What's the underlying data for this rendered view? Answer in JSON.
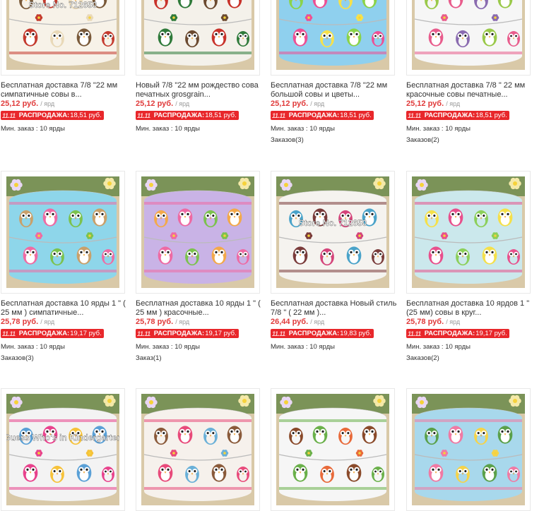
{
  "sale_badge": "11.11",
  "products": [
    {
      "title": "Бесплатная доставка 7/8 \"22 мм симпатичные совы в...",
      "price": "25,12 руб.",
      "unit": "/ ярд",
      "sale_label": "РАСПРОДАЖА:",
      "sale_price": "18,51 руб.",
      "min_order": "Мин. заказ : 10 ярды",
      "orders": "",
      "watermark": "Store No. 712650",
      "colors": [
        "#f7f2e8",
        "#c43a2e",
        "#7a5a3a",
        "#e9d9b8"
      ]
    },
    {
      "title": "Новый 7/8 \"22 мм рождество сова печатных grosgrain...",
      "price": "25,12 руб.",
      "unit": "/ ярд",
      "sale_label": "РАСПРОДАЖА:",
      "sale_price": "18,51 руб.",
      "min_order": "Мин. заказ : 10 ярды",
      "orders": "",
      "watermark": "",
      "colors": [
        "#f4f1ea",
        "#2f7a3a",
        "#c8322a",
        "#6b4a30"
      ]
    },
    {
      "title": "Бесплатная доставка 7/8 \"22 мм большой совы и цветы...",
      "price": "25,12 руб.",
      "unit": "/ ярд",
      "sale_label": "РАСПРОДАЖА:",
      "sale_price": "18,51 руб.",
      "min_order": "Мин. заказ : 10 ярды",
      "orders": "Заказов(3)",
      "watermark": "",
      "colors": [
        "#8fd0ee",
        "#ee4f93",
        "#8bd34a",
        "#f7e14a"
      ]
    },
    {
      "title": "Бесплатная доставка 7/8 \" 22 мм красочные совы печатные...",
      "price": "25,12 руб.",
      "unit": "/ ярд",
      "sale_label": "РАСПРОДАЖА:",
      "sale_price": "18,51 руб.",
      "min_order": "Мин. заказ : 10 ярды",
      "orders": "Заказов(2)",
      "watermark": "",
      "colors": [
        "#f6f6f6",
        "#e85c8c",
        "#9ac94a",
        "#8a6bb0"
      ]
    },
    {
      "title": "Бесплатная доставка 10 ярды 1 \" ( 25 мм ) симпатичные...",
      "price": "25,78 руб.",
      "unit": "/ ярд",
      "sale_label": "РАСПРОДАЖА:",
      "sale_price": "19,17 руб.",
      "min_order": "Мин. заказ : 10 ярды",
      "orders": "Заказов(3)",
      "watermark": "",
      "colors": [
        "#8ed6ea",
        "#ef6ba3",
        "#c9a06a",
        "#7cc24e"
      ]
    },
    {
      "title": "Бесплатная доставка 10 ярды 1 \" ( 25 мм ) красочные...",
      "price": "25,78 руб.",
      "unit": "/ ярд",
      "sale_label": "РАСПРОДАЖА:",
      "sale_price": "19,17 руб.",
      "min_order": "Мин. заказ : 10 ярды",
      "orders": "Заказ(1)",
      "watermark": "",
      "colors": [
        "#c9b3e6",
        "#ee6aa3",
        "#f3a94a",
        "#7cc24e"
      ]
    },
    {
      "title": "Бесплатная доставка Новый стиль 7/8 \" ( 22 мм )...",
      "price": "26,44 руб.",
      "unit": "/ ярд",
      "sale_label": "РАСПРОДАЖА:",
      "sale_price": "19,83 руб.",
      "min_order": "Мин. заказ : 10 ярды",
      "orders": "",
      "watermark": "Store No. 712650",
      "colors": [
        "#f5f3ef",
        "#7a3b3a",
        "#4aa3c9",
        "#d4447a"
      ]
    },
    {
      "title": "Бесплатная доставка 10 ярдов 1 \"(25 мм) совы в круг...",
      "price": "25,78 руб.",
      "unit": "/ ярд",
      "sale_label": "РАСПРОДАЖА:",
      "sale_price": "19,17 руб.",
      "min_order": "Мин. заказ : 10 ярды",
      "orders": "Заказов(2)",
      "watermark": "",
      "colors": [
        "#cbe8ec",
        "#e8508c",
        "#f5e04a",
        "#8ccf5a"
      ]
    },
    {
      "title": "",
      "price": "",
      "unit": "",
      "sale_label": "",
      "sale_price": "",
      "min_order": "",
      "orders": "",
      "watermark": "Guess Who's in Kindergarten",
      "colors": [
        "#f3f3f3",
        "#e8428c",
        "#5aa0d6",
        "#f6c23a"
      ]
    },
    {
      "title": "",
      "price": "",
      "unit": "",
      "sale_label": "",
      "sale_price": "",
      "min_order": "",
      "orders": "",
      "watermark": "",
      "colors": [
        "#f6f1ec",
        "#e84a7a",
        "#8a5a3a",
        "#6ab0d8"
      ]
    },
    {
      "title": "",
      "price": "",
      "unit": "",
      "sale_label": "",
      "sale_price": "",
      "min_order": "",
      "orders": "",
      "watermark": "",
      "colors": [
        "#f6f6f6",
        "#6ab04a",
        "#8a4a2a",
        "#e86a3a"
      ]
    },
    {
      "title": "",
      "price": "",
      "unit": "",
      "sale_label": "",
      "sale_price": "",
      "min_order": "",
      "orders": "",
      "watermark": "",
      "colors": [
        "#a8d8ec",
        "#f07aa3",
        "#5aa04a",
        "#f5d34a"
      ]
    }
  ]
}
